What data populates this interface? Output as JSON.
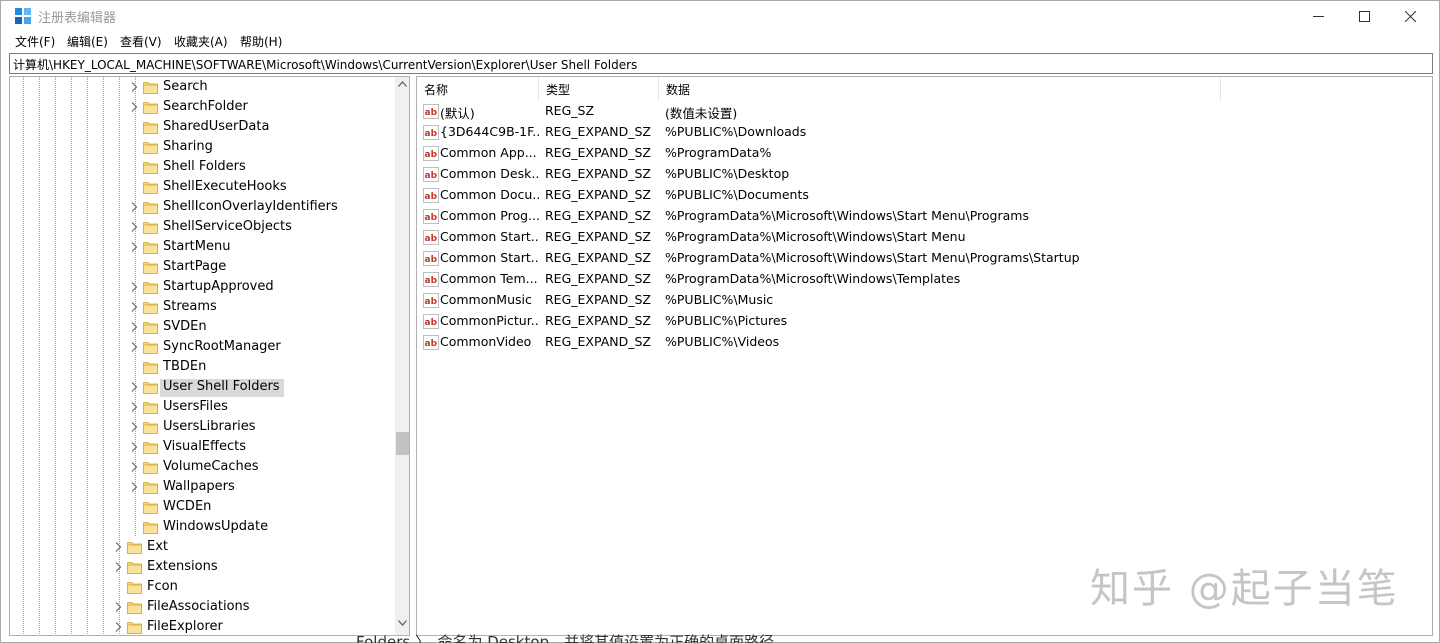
{
  "window": {
    "title": "注册表编辑器",
    "min_label": "—",
    "max_label": "☐",
    "close_label": "✕"
  },
  "menu": [
    "文件(F)",
    "编辑(E)",
    "查看(V)",
    "收藏夹(A)",
    "帮助(H)"
  ],
  "address": "计算机\\HKEY_LOCAL_MACHINE\\SOFTWARE\\Microsoft\\Windows\\CurrentVersion\\Explorer\\User Shell Folders",
  "tree": {
    "items": [
      {
        "label": "Search",
        "expandable": true,
        "level": 2,
        "selected": false
      },
      {
        "label": "SearchFolder",
        "expandable": true,
        "level": 2,
        "selected": false
      },
      {
        "label": "SharedUserData",
        "expandable": false,
        "level": 2,
        "selected": false
      },
      {
        "label": "Sharing",
        "expandable": false,
        "level": 2,
        "selected": false
      },
      {
        "label": "Shell Folders",
        "expandable": false,
        "level": 2,
        "selected": false
      },
      {
        "label": "ShellExecuteHooks",
        "expandable": false,
        "level": 2,
        "selected": false
      },
      {
        "label": "ShellIconOverlayIdentifiers",
        "expandable": true,
        "level": 2,
        "selected": false
      },
      {
        "label": "ShellServiceObjects",
        "expandable": true,
        "level": 2,
        "selected": false
      },
      {
        "label": "StartMenu",
        "expandable": true,
        "level": 2,
        "selected": false
      },
      {
        "label": "StartPage",
        "expandable": false,
        "level": 2,
        "selected": false
      },
      {
        "label": "StartupApproved",
        "expandable": true,
        "level": 2,
        "selected": false
      },
      {
        "label": "Streams",
        "expandable": true,
        "level": 2,
        "selected": false
      },
      {
        "label": "SVDEn",
        "expandable": true,
        "level": 2,
        "selected": false
      },
      {
        "label": "SyncRootManager",
        "expandable": true,
        "level": 2,
        "selected": false
      },
      {
        "label": "TBDEn",
        "expandable": false,
        "level": 2,
        "selected": false
      },
      {
        "label": "User Shell Folders",
        "expandable": true,
        "level": 2,
        "selected": true
      },
      {
        "label": "UsersFiles",
        "expandable": true,
        "level": 2,
        "selected": false
      },
      {
        "label": "UsersLibraries",
        "expandable": true,
        "level": 2,
        "selected": false
      },
      {
        "label": "VisualEffects",
        "expandable": true,
        "level": 2,
        "selected": false
      },
      {
        "label": "VolumeCaches",
        "expandable": true,
        "level": 2,
        "selected": false
      },
      {
        "label": "Wallpapers",
        "expandable": true,
        "level": 2,
        "selected": false
      },
      {
        "label": "WCDEn",
        "expandable": false,
        "level": 2,
        "selected": false
      },
      {
        "label": "WindowsUpdate",
        "expandable": false,
        "level": 2,
        "selected": false
      },
      {
        "label": "Ext",
        "expandable": true,
        "level": 1,
        "selected": false
      },
      {
        "label": "Extensions",
        "expandable": true,
        "level": 1,
        "selected": false
      },
      {
        "label": "Fcon",
        "expandable": false,
        "level": 1,
        "selected": false
      },
      {
        "label": "FileAssociations",
        "expandable": true,
        "level": 1,
        "selected": false
      },
      {
        "label": "FileExplorer",
        "expandable": true,
        "level": 1,
        "selected": false
      }
    ]
  },
  "list": {
    "columns": [
      "名称",
      "类型",
      "数据"
    ],
    "rows": [
      {
        "name": "(默认)",
        "type": "REG_SZ",
        "data": "(数值未设置)"
      },
      {
        "name": "{3D644C9B-1F...",
        "type": "REG_EXPAND_SZ",
        "data": "%PUBLIC%\\Downloads"
      },
      {
        "name": "Common App...",
        "type": "REG_EXPAND_SZ",
        "data": "%ProgramData%"
      },
      {
        "name": "Common Desk...",
        "type": "REG_EXPAND_SZ",
        "data": "%PUBLIC%\\Desktop"
      },
      {
        "name": "Common Docu...",
        "type": "REG_EXPAND_SZ",
        "data": "%PUBLIC%\\Documents"
      },
      {
        "name": "Common Prog...",
        "type": "REG_EXPAND_SZ",
        "data": "%ProgramData%\\Microsoft\\Windows\\Start Menu\\Programs"
      },
      {
        "name": "Common Start...",
        "type": "REG_EXPAND_SZ",
        "data": "%ProgramData%\\Microsoft\\Windows\\Start Menu"
      },
      {
        "name": "Common Start...",
        "type": "REG_EXPAND_SZ",
        "data": "%ProgramData%\\Microsoft\\Windows\\Start Menu\\Programs\\Startup"
      },
      {
        "name": "Common Tem...",
        "type": "REG_EXPAND_SZ",
        "data": "%ProgramData%\\Microsoft\\Windows\\Templates"
      },
      {
        "name": "CommonMusic",
        "type": "REG_EXPAND_SZ",
        "data": "%PUBLIC%\\Music"
      },
      {
        "name": "CommonPictur...",
        "type": "REG_EXPAND_SZ",
        "data": "%PUBLIC%\\Pictures"
      },
      {
        "name": "CommonVideo",
        "type": "REG_EXPAND_SZ",
        "data": "%PUBLIC%\\Videos"
      }
    ]
  },
  "value_icon_text": "ab",
  "watermark": "知乎 @起子当笔",
  "caption": "Folders 〉，命名为 Desktop，并将其值设置为正确的桌面路径"
}
